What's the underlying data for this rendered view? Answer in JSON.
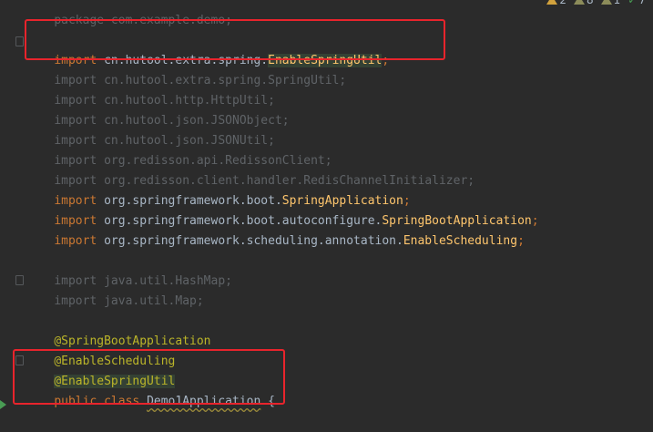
{
  "code": {
    "package_line": "package com.example.demo;",
    "lines": [
      {
        "kw": "import",
        "pkg": " cn.hutool.extra.spring.",
        "cls": "EnableSpringUtil",
        "semi": ";"
      },
      {
        "kw": "import",
        "pkg": " cn.hutool.extra.spring.",
        "cls": "SpringUtil",
        "semi": ";"
      },
      {
        "kw": "import",
        "pkg": " cn.hutool.http.",
        "cls": "HttpUtil",
        "semi": ";"
      },
      {
        "kw": "import",
        "pkg": " cn.hutool.json.",
        "cls": "JSONObject",
        "semi": ";"
      },
      {
        "kw": "import",
        "pkg": " cn.hutool.json.",
        "cls": "JSONUtil",
        "semi": ";"
      },
      {
        "kw": "import",
        "pkg": " org.redisson.api.",
        "cls": "RedissonClient",
        "semi": ";"
      },
      {
        "kw": "import",
        "pkg": " org.redisson.client.handler.",
        "cls": "RedisChannelInitializer",
        "semi": ";"
      },
      {
        "kw": "import",
        "pkg": " org.springframework.boot.",
        "cls": "SpringApplication",
        "semi": ";"
      },
      {
        "kw": "import",
        "pkg": " org.springframework.boot.autoconfigure.",
        "cls": "SpringBootApplication",
        "semi": ";"
      },
      {
        "kw": "import",
        "pkg": " org.springframework.scheduling.annotation.",
        "cls": "EnableScheduling",
        "semi": ";"
      },
      {
        "kw": "import",
        "pkg": " java.util.",
        "cls": "HashMap",
        "semi": ";"
      },
      {
        "kw": "import",
        "pkg": " java.util.",
        "cls": "Map",
        "semi": ";"
      }
    ],
    "annotations": [
      "@SpringBootApplication",
      "@EnableScheduling",
      "@EnableSpringUtil"
    ],
    "class_decl": {
      "kw1": "public",
      "kw2": "class",
      "name": "Demo1Application",
      "brace": "{"
    }
  },
  "indicators": [
    {
      "icon": "warning-icon",
      "count": "2"
    },
    {
      "icon": "weak-warning-icon",
      "count": "8"
    },
    {
      "icon": "typo-icon",
      "count": "1"
    },
    {
      "icon": "check-icon",
      "count": "7"
    }
  ],
  "colors": {
    "background": "#2b2b2b",
    "keyword": "#cc7832",
    "annotation": "#bbb529",
    "unused": "#5f6367",
    "highlight_box": "#e8242c"
  }
}
